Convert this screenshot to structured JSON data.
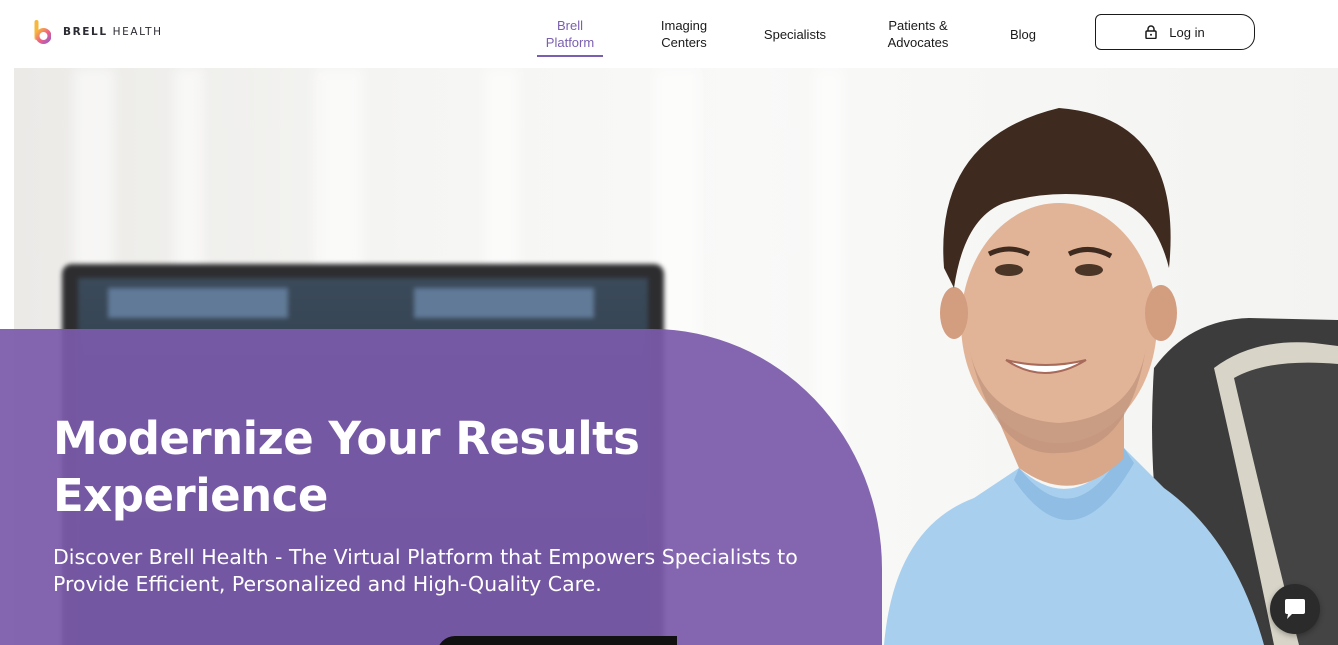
{
  "brand": {
    "name_bold": "BRELL",
    "name_light": "HEALTH",
    "logo_icon": "brell-b-logo-icon"
  },
  "nav": {
    "items": [
      {
        "label": "Brell\nPlatform",
        "active": true
      },
      {
        "label": "Imaging\nCenters",
        "active": false
      },
      {
        "label": "Specialists",
        "active": false
      },
      {
        "label": "Patients &\nAdvocates",
        "active": false
      },
      {
        "label": "Blog",
        "active": false
      }
    ],
    "login": {
      "label": "Log in",
      "icon": "lock-icon"
    }
  },
  "hero": {
    "title": "Modernize Your Results Experience",
    "subtitle": "Discover Brell Health - The Virtual Platform that Empowers Specialists to Provide Efficient, Personalized and High-Quality Care."
  },
  "chat": {
    "icon": "chat-bubble-icon"
  },
  "colors": {
    "accent": "#7a5fb0",
    "panel": "#7b5aaa",
    "text_dark": "#1a1a1a",
    "scrubs": "#a9cfee"
  }
}
